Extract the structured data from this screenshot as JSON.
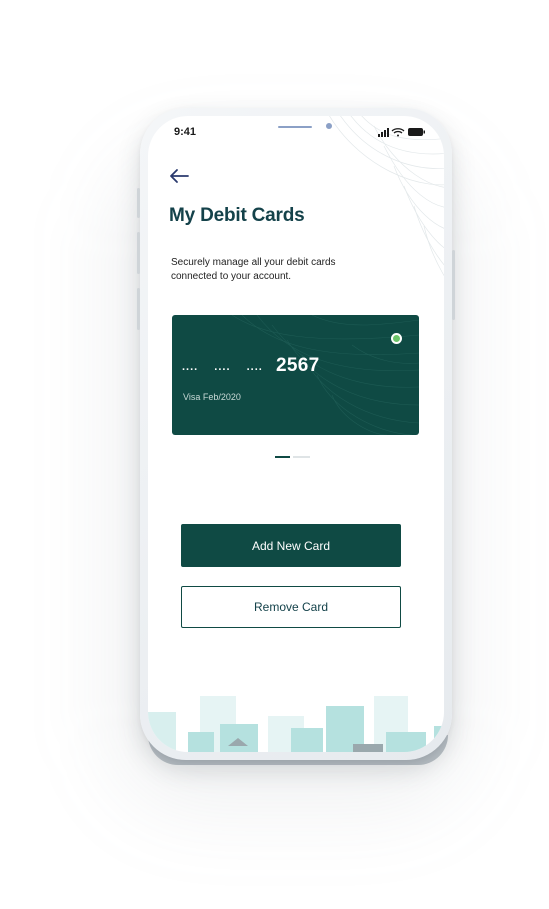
{
  "status_bar": {
    "time": "9:41",
    "icons": [
      "signal-icon",
      "wifi-icon",
      "battery-icon"
    ]
  },
  "header": {
    "back_icon": "arrow-left-icon",
    "title": "My Debit Cards",
    "subtitle": "Securely manage all your debit cards connected to your account."
  },
  "card": {
    "masked_groups": [
      "....",
      "....",
      "...."
    ],
    "last4": "2567",
    "meta": "Visa Feb/2020",
    "status_color": "#6cc46a",
    "background_color": "#0f4a44"
  },
  "pager": {
    "total": 2,
    "active_index": 0
  },
  "actions": {
    "add_label": "Add New Card",
    "remove_label": "Remove Card"
  },
  "colors": {
    "brand": "#0f4a44",
    "title": "#14424a",
    "skyline": "#b5e1df"
  }
}
